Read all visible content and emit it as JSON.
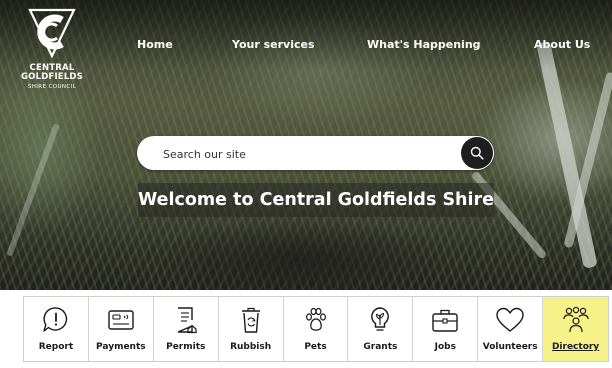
{
  "logo": {
    "line1": "CENTRAL",
    "line2": "GOLDFIELDS",
    "line3": "SHIRE COUNCIL",
    "icon": "goldfields-logo-icon"
  },
  "nav": {
    "items": [
      {
        "label": "Home"
      },
      {
        "label": "Your services"
      },
      {
        "label": "What's Happening"
      },
      {
        "label": "About Us"
      }
    ]
  },
  "search": {
    "placeholder": "Search our site",
    "icon": "search-icon"
  },
  "hero": {
    "heading": "Welcome to Central Goldfields Shire"
  },
  "tiles": {
    "items": [
      {
        "label": "Report",
        "icon": "exclamation-bubble-icon"
      },
      {
        "label": "Payments",
        "icon": "card-icon"
      },
      {
        "label": "Permits",
        "icon": "document-icon"
      },
      {
        "label": "Rubbish",
        "icon": "recycle-bin-icon"
      },
      {
        "label": "Pets",
        "icon": "paw-icon"
      },
      {
        "label": "Grants",
        "icon": "lightbulb-icon"
      },
      {
        "label": "Jobs",
        "icon": "briefcase-icon"
      },
      {
        "label": "Volunteers",
        "icon": "heart-icon"
      },
      {
        "label": "Directory",
        "icon": "people-icon"
      }
    ],
    "active": "Directory",
    "active_color": "#f7f18a"
  },
  "colors": {
    "text_dark": "#1a1a1a",
    "search_button": "#1e1e1e"
  }
}
